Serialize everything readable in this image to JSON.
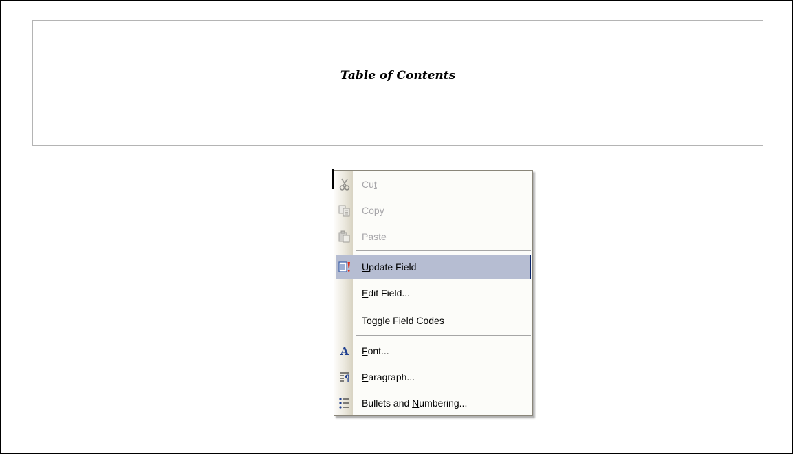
{
  "document": {
    "toc_title": "Table of Contents"
  },
  "context_menu": {
    "items": [
      {
        "label_pre": "Cu",
        "accel": "t",
        "label_post": "",
        "icon": "scissors-icon",
        "enabled": false
      },
      {
        "label_pre": "",
        "accel": "C",
        "label_post": "opy",
        "icon": "copy-icon",
        "enabled": false
      },
      {
        "label_pre": "",
        "accel": "P",
        "label_post": "aste",
        "icon": "paste-icon",
        "enabled": false
      },
      {
        "label_pre": "",
        "accel": "U",
        "label_post": "pdate Field",
        "icon": "update-field-icon",
        "enabled": true,
        "highlighted": true
      },
      {
        "label_pre": "",
        "accel": "E",
        "label_post": "dit Field...",
        "icon": "",
        "enabled": true
      },
      {
        "label_pre": "",
        "accel": "T",
        "label_post": "oggle Field Codes",
        "icon": "",
        "enabled": true
      },
      {
        "label_pre": "",
        "accel": "F",
        "label_post": "ont...",
        "icon": "font-icon",
        "enabled": true
      },
      {
        "label_pre": "",
        "accel": "P",
        "label_post": "aragraph...",
        "icon": "paragraph-icon",
        "enabled": true
      },
      {
        "label_pre": "Bullets and ",
        "accel": "N",
        "label_post": "umbering...",
        "icon": "bullets-numbering-icon",
        "enabled": true
      }
    ]
  },
  "colors": {
    "highlight_fill": "#b6bdd2",
    "highlight_border": "#0a246a",
    "disabled_text": "#a7a6aa"
  }
}
